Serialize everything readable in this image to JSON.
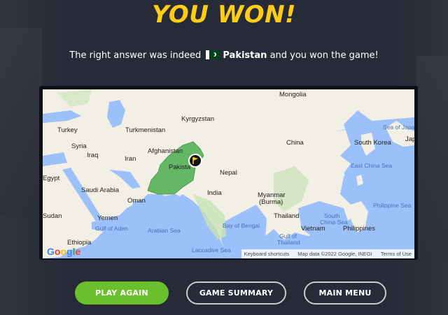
{
  "header": {
    "title": "YOU WON!",
    "result_prefix": "The right answer was indeed",
    "country_name": "Pakistan",
    "result_suffix": "and you won the game!"
  },
  "map": {
    "labels": {
      "mongolia": "Mongolia",
      "kyrgyzstan": "Kyrgyzstan",
      "turkey": "Turkey",
      "turkmenistan": "Turkmenistan",
      "syria": "Syria",
      "iraq": "Iraq",
      "iran": "Iran",
      "afghanistan": "Afghanistan",
      "pakistan": "Pakista",
      "china": "China",
      "south_korea": "South Korea",
      "japan": "Jap",
      "sea_of_japan_1": "Sea of Japan",
      "sea_of_japan_2": "",
      "nepal": "Nepal",
      "egypt": "Egypt",
      "saudi_arabia": "Saudi Arabia",
      "india": "India",
      "myanmar": "Myanmar",
      "burma": "(Burma)",
      "east_china_sea": "East China Sea",
      "oman": "Oman",
      "philippine_sea": "Philippine Sea",
      "sudan": "Sudan",
      "thailand": "Thailand",
      "south_1": "South",
      "china_sea": "China Sea",
      "yemen": "Yemen",
      "vietnam": "Vietnam",
      "philippines": "Philippines",
      "gulf_of_aden": "Gulf of Aden",
      "arabian_sea": "Arabian Sea",
      "bay_of_bengal": "Bay of Bengal",
      "ethiopia": "Ethiopia",
      "gulf_of": "Gulf of",
      "thailand_gulf": "Thailand",
      "laccadive_sea": "Laccadive Sea"
    },
    "attribution": {
      "shortcuts": "Keyboard shortcuts",
      "data": "Map data ©2022 Google, INEGI",
      "terms": "Terms of Use"
    },
    "logo": "Google",
    "marker_icon": "flag-icon"
  },
  "buttons": {
    "play_again": "PLAY AGAIN",
    "game_summary": "GAME SUMMARY",
    "main_menu": "MAIN MENU"
  },
  "colors": {
    "title": "#ffcc1a",
    "play_button": "#6abf2c",
    "highlight_country": "#4caf50"
  }
}
